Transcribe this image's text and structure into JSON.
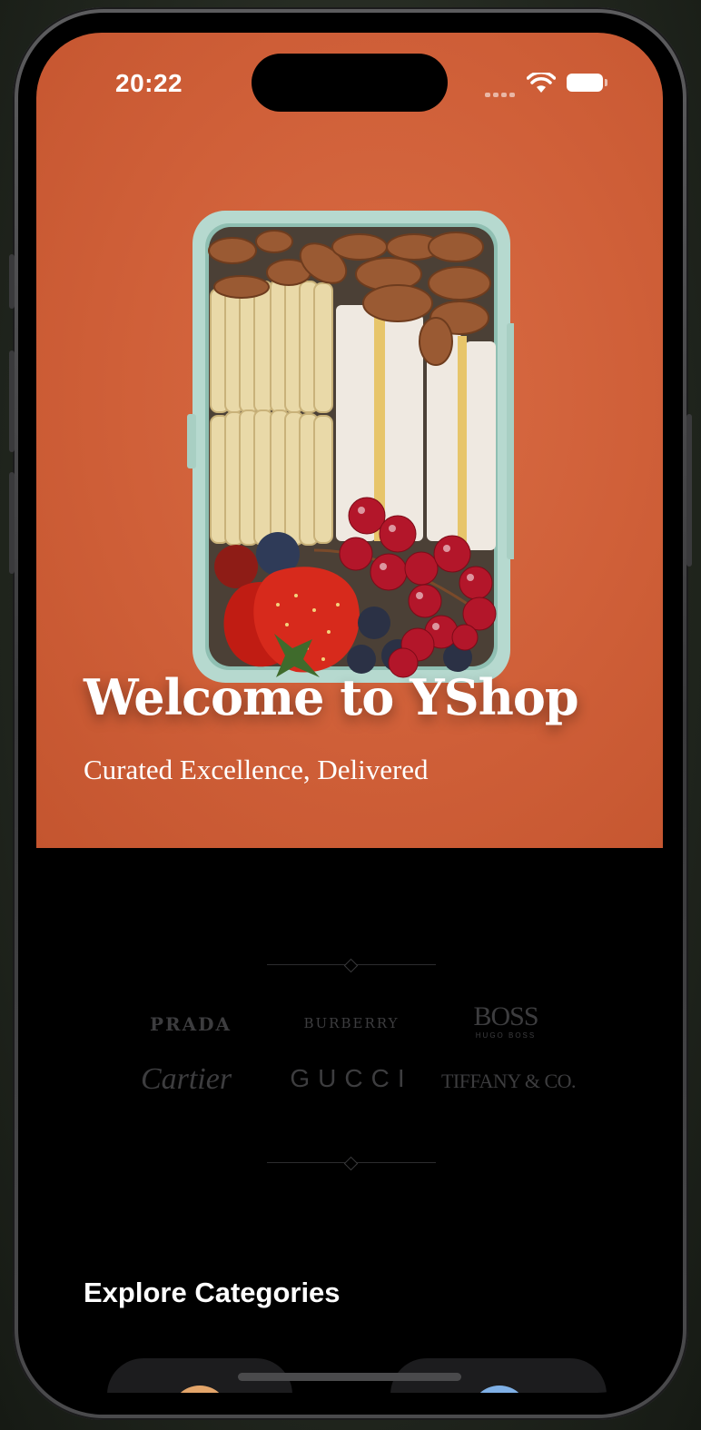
{
  "status_bar": {
    "time": "20:22",
    "signal_icon": "signal-icon",
    "wifi_icon": "wifi-icon",
    "battery_icon": "battery-icon"
  },
  "hero": {
    "title": "Welcome to YShop",
    "subtitle": "Curated Excellence, Delivered",
    "background_color": "#cf5f38",
    "image": "lunchbox-photo"
  },
  "brands": {
    "prada": "PRADA",
    "burberry": "BURBERRY",
    "boss": "BOSS",
    "boss_sub": "HUGO BOSS",
    "cartier": "Cartier",
    "gucci": "GUCCI",
    "tiffany": "TIFFANY & CO."
  },
  "categories": {
    "title": "Explore Categories",
    "items": [
      {
        "accent": "#e3a56a"
      },
      {
        "accent": "#7fb0e6"
      }
    ]
  }
}
